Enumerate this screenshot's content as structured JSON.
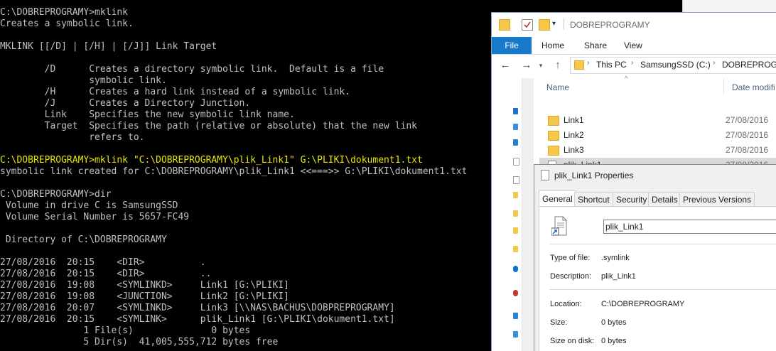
{
  "console": {
    "lines": [
      {
        "text": "C:\\DOBREPROGRAMY>mklink",
        "color": "#c0c0c0"
      },
      {
        "text": "Creates a symbolic link.",
        "color": "#c0c0c0"
      },
      {
        "text": "",
        "color": "#c0c0c0"
      },
      {
        "text": "MKLINK [[/D] | [/H] | [/J]] Link Target",
        "color": "#c0c0c0"
      },
      {
        "text": "",
        "color": "#c0c0c0"
      },
      {
        "text": "        /D      Creates a directory symbolic link.  Default is a file",
        "color": "#c0c0c0"
      },
      {
        "text": "                symbolic link.",
        "color": "#c0c0c0"
      },
      {
        "text": "        /H      Creates a hard link instead of a symbolic link.",
        "color": "#c0c0c0"
      },
      {
        "text": "        /J      Creates a Directory Junction.",
        "color": "#c0c0c0"
      },
      {
        "text": "        Link    Specifies the new symbolic link name.",
        "color": "#c0c0c0"
      },
      {
        "text": "        Target  Specifies the path (relative or absolute) that the new link",
        "color": "#c0c0c0"
      },
      {
        "text": "                refers to.",
        "color": "#c0c0c0"
      },
      {
        "text": "",
        "color": "#c0c0c0"
      },
      {
        "text": "C:\\DOBREPROGRAMY>mklink \"C:\\DOBREPROGRAMY\\plik_Link1\" G:\\PLIKI\\dokument1.txt",
        "color": "#e6e600"
      },
      {
        "text": "symbolic link created for C:\\DOBREPROGRAMY\\plik_Link1 <<===>> G:\\PLIKI\\dokument1.txt",
        "color": "#c0c0c0"
      },
      {
        "text": "",
        "color": "#c0c0c0"
      },
      {
        "text": "C:\\DOBREPROGRAMY>dir",
        "color": "#c0c0c0"
      },
      {
        "text": " Volume in drive C is SamsungSSD",
        "color": "#c0c0c0"
      },
      {
        "text": " Volume Serial Number is 5657-FC49",
        "color": "#c0c0c0"
      },
      {
        "text": "",
        "color": "#c0c0c0"
      },
      {
        "text": " Directory of C:\\DOBREPROGRAMY",
        "color": "#c0c0c0"
      },
      {
        "text": "",
        "color": "#c0c0c0"
      },
      {
        "text": "27/08/2016  20:15    <DIR>          .",
        "color": "#c0c0c0"
      },
      {
        "text": "27/08/2016  20:15    <DIR>          ..",
        "color": "#c0c0c0"
      },
      {
        "text": "27/08/2016  19:08    <SYMLINKD>     Link1 [G:\\PLIKI]",
        "color": "#c0c0c0"
      },
      {
        "text": "27/08/2016  19:08    <JUNCTION>     Link2 [G:\\PLIKI]",
        "color": "#c0c0c0"
      },
      {
        "text": "27/08/2016  20:07    <SYMLINKD>     Link3 [\\\\NAS\\BACHUS\\DOBPREPROGRAMY]",
        "color": "#c0c0c0"
      },
      {
        "text": "27/08/2016  20:15    <SYMLINK>      plik_Link1 [G:\\PLIKI\\dokument1.txt]",
        "color": "#c0c0c0"
      },
      {
        "text": "               1 File(s)              0 bytes",
        "color": "#c0c0c0"
      },
      {
        "text": "               5 Dir(s)  41,005,555,712 bytes free",
        "color": "#c0c0c0"
      }
    ]
  },
  "explorer": {
    "title": "DOBREPROGRAMY",
    "ribbon_tabs": [
      "File",
      "Home",
      "Share",
      "View"
    ],
    "breadcrumbs": [
      "This PC",
      "SamsungSSD (C:)",
      "DOBREPROGRAMY"
    ],
    "columns": {
      "name": "Name",
      "date": "Date modifi"
    },
    "files": [
      {
        "name": "Link1",
        "date": "27/08/2016",
        "type": "folder"
      },
      {
        "name": "Link2",
        "date": "27/08/2016",
        "type": "folder"
      },
      {
        "name": "Link3",
        "date": "27/08/2016",
        "type": "folder"
      },
      {
        "name": "plik_Link1",
        "date": "27/08/2016",
        "type": "file",
        "selected": true
      }
    ]
  },
  "properties": {
    "title": "plik_Link1 Properties",
    "tabs": [
      "General",
      "Shortcut",
      "Security",
      "Details",
      "Previous Versions"
    ],
    "name_value": "plik_Link1",
    "fields": [
      {
        "label": "Type of file:",
        "value": ".symlink"
      },
      {
        "label": "Description:",
        "value": "plik_Link1"
      },
      {
        "label": "Location:",
        "value": "C:\\DOBREPROGRAMY"
      },
      {
        "label": "Size:",
        "value": "0 bytes"
      },
      {
        "label": "Size on disk:",
        "value": "0 bytes"
      }
    ]
  },
  "colors": {
    "file_tab": "#1979ca",
    "console_highlight": "#e6e600",
    "folder": "#f5c74a"
  }
}
